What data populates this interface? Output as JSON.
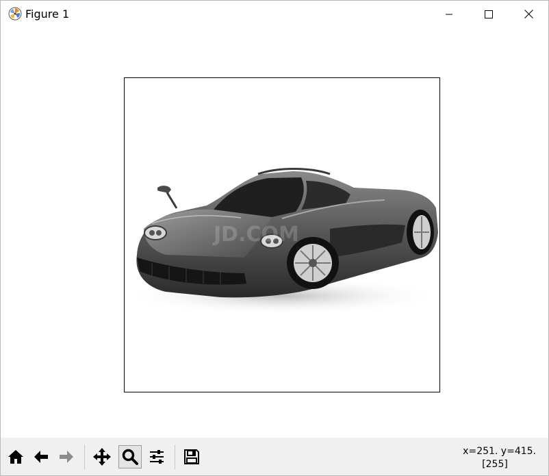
{
  "window": {
    "title": "Figure 1",
    "controls": [
      "minimize-icon",
      "maximize-icon",
      "close-icon"
    ]
  },
  "figure": {
    "image_description_icon": "car-photo",
    "watermark": "JD.COM"
  },
  "toolbar": {
    "buttons": [
      {
        "name": "home-button",
        "icon": "home-icon"
      },
      {
        "name": "back-button",
        "icon": "left-arrow-icon"
      },
      {
        "name": "forward-button",
        "icon": "right-arrow-icon"
      },
      {
        "name": "pan-button",
        "icon": "move-icon"
      },
      {
        "name": "zoom-button",
        "icon": "magnifier-icon",
        "active": true
      },
      {
        "name": "configure-subplots-button",
        "icon": "sliders-icon"
      },
      {
        "name": "save-button",
        "icon": "floppy-icon"
      }
    ]
  },
  "status": {
    "coords": "x=251. y=415.",
    "pixel_value": "[255]"
  }
}
